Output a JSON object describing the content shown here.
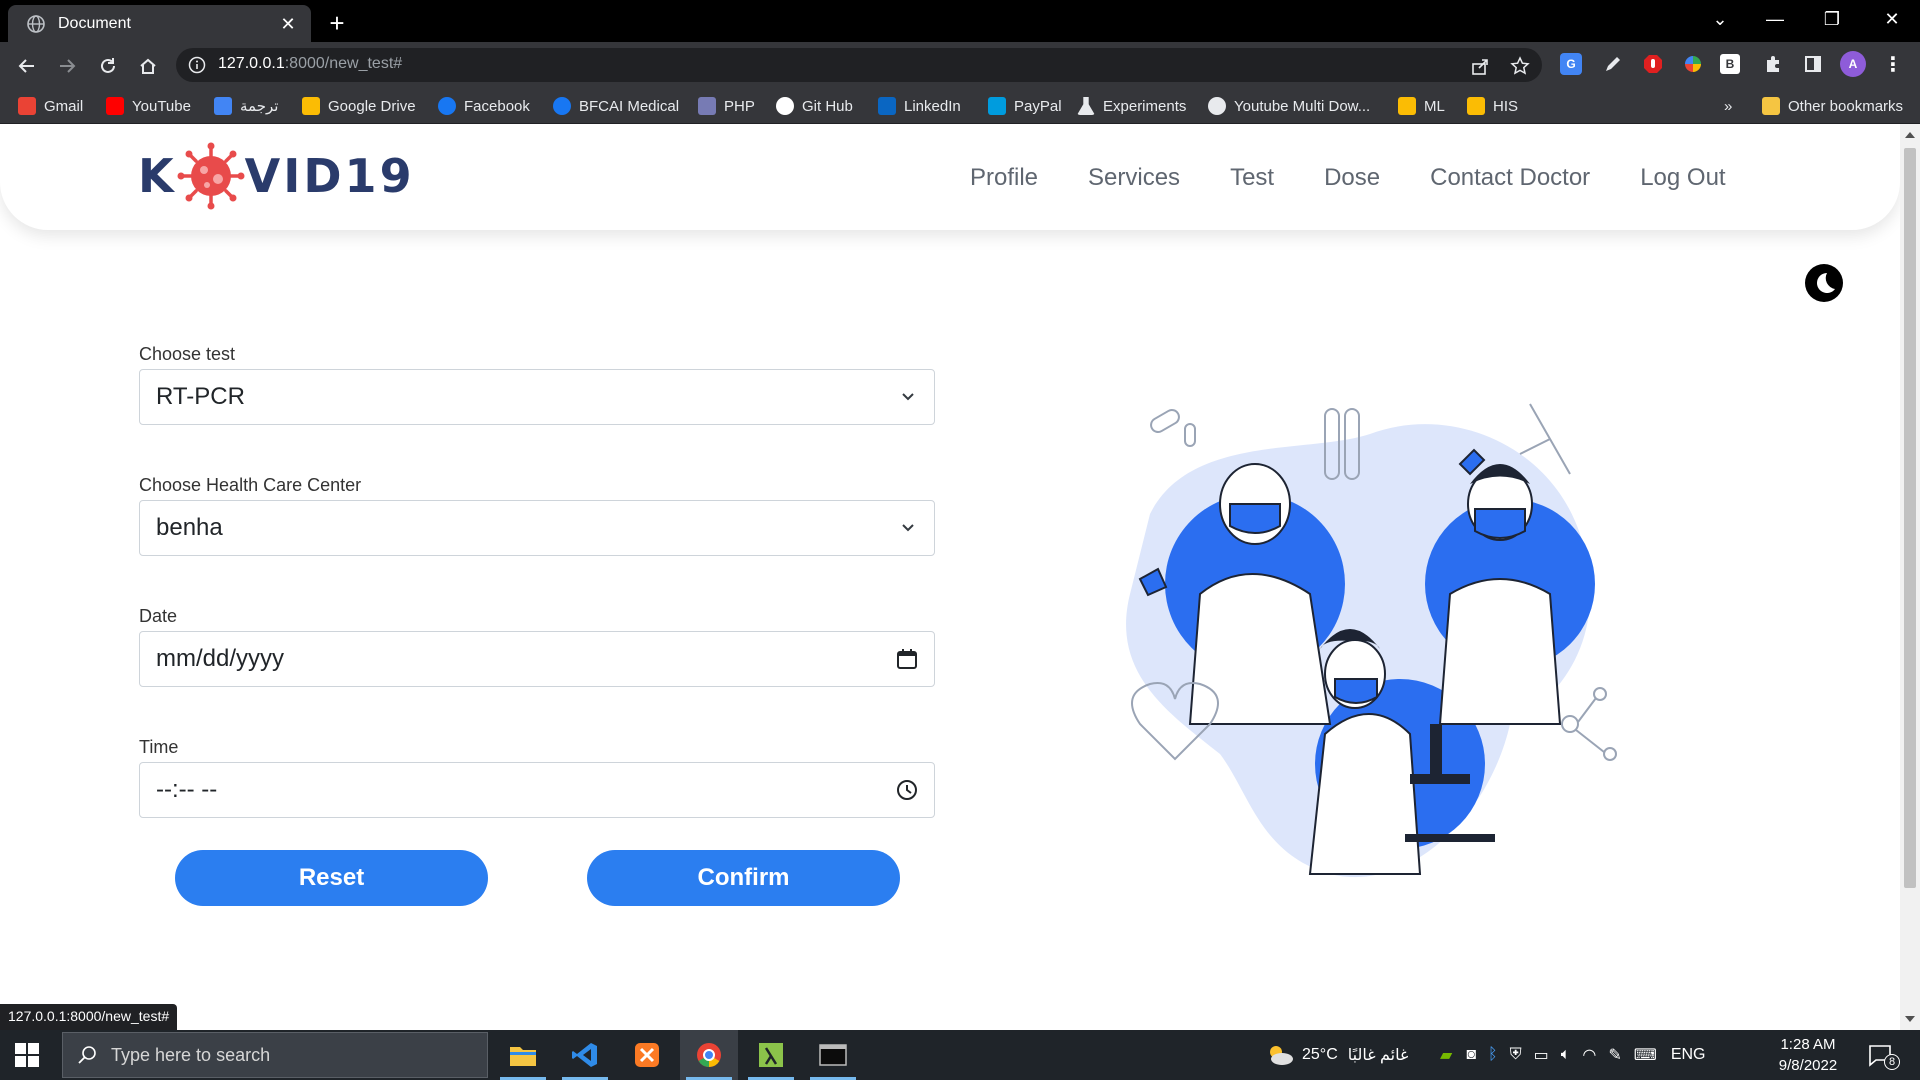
{
  "browser": {
    "tab_title": "Document",
    "url_host": "127.0.0.1",
    "url_rest": ":8000/new_test#",
    "status_url": "127.0.0.1:8000/new_test#",
    "profile_initial": "A",
    "bookmarks": [
      {
        "label": "Gmail",
        "icon": "gmail-icon",
        "color": "#ea4335"
      },
      {
        "label": "YouTube",
        "icon": "youtube-icon",
        "color": "#ff0000"
      },
      {
        "label": "ترجمة",
        "icon": "translate-icon",
        "color": "#4285f4"
      },
      {
        "label": "Google Drive",
        "icon": "google-drive-icon",
        "color": "#fbbc04"
      },
      {
        "label": "Facebook",
        "icon": "facebook-icon",
        "color": "#1877f2"
      },
      {
        "label": "BFCAI Medical",
        "icon": "facebook-icon",
        "color": "#1877f2"
      },
      {
        "label": "PHP",
        "icon": "php-icon",
        "color": "#777bb4"
      },
      {
        "label": "Git Hub",
        "icon": "github-icon",
        "color": "#ffffff"
      },
      {
        "label": "LinkedIn",
        "icon": "linkedin-icon",
        "color": "#0a66c2"
      },
      {
        "label": "PayPal",
        "icon": "paypal-icon",
        "color": "#009cde"
      },
      {
        "label": "Experiments",
        "icon": "flask-icon",
        "color": "#ffffff"
      },
      {
        "label": "Youtube Multi Dow...",
        "icon": "globe-icon",
        "color": "#ffffff"
      },
      {
        "label": "ML",
        "icon": "google-drive-icon",
        "color": "#fbbc04"
      },
      {
        "label": "HIS",
        "icon": "google-drive-icon",
        "color": "#fbbc04"
      }
    ],
    "more_bookmarks": "»",
    "other_bookmarks": "Other bookmarks"
  },
  "site": {
    "logo_left": "K",
    "logo_right": "VID19",
    "nav": [
      "Profile",
      "Services",
      "Test",
      "Dose",
      "Contact Doctor",
      "Log Out"
    ]
  },
  "form": {
    "test_label": "Choose test",
    "test_value": "RT-PCR",
    "center_label": "Choose Health Care Center",
    "center_value": "benha",
    "date_label": "Date",
    "date_value": "mm/dd/yyyy",
    "time_label": "Time",
    "time_value": "--:-- --",
    "reset_label": "Reset",
    "confirm_label": "Confirm"
  },
  "taskbar": {
    "search_placeholder": "Type here to search",
    "weather": "25°C",
    "weather_text": "غائم غالبًا",
    "language": "ENG",
    "time": "1:28 AM",
    "date": "9/8/2022",
    "notification_count": "8"
  },
  "colors": {
    "accent": "#2b7ef0",
    "logo_text": "#2a3b6b",
    "virus": "#e84b4b"
  }
}
